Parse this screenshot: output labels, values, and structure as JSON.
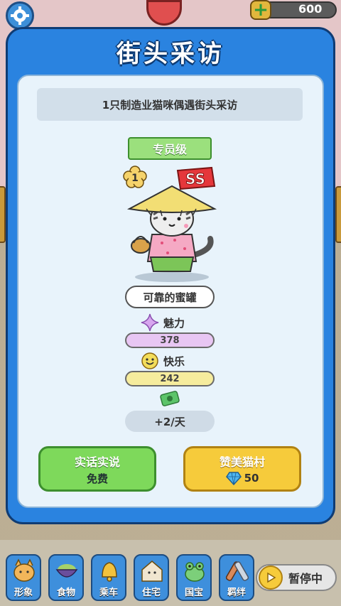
{
  "top_bar": {
    "currency_value": "600",
    "currency_icon": "plus-icon",
    "settings_icon": "gear-icon"
  },
  "dialog": {
    "title": "街头采访",
    "subtitle": "1只制造业猫咪偶遇街头采访",
    "rank": "专员级",
    "level": "1",
    "grade": "SS",
    "cat_name": "可靠的蜜罐",
    "charm": {
      "label": "魅力",
      "value": "378",
      "icon": "sparkle-icon",
      "color": "#d7a6ef"
    },
    "happiness": {
      "label": "快乐",
      "value": "242",
      "icon": "smiley-icon",
      "color": "#f3dd5a"
    },
    "income": {
      "value": "+2/天",
      "icon": "money-icon"
    },
    "buttons": {
      "honest": {
        "label": "实话实说",
        "sub": "免费"
      },
      "praise": {
        "label": "赞美猫村",
        "sub": "50",
        "icon": "diamond-icon"
      }
    }
  },
  "bottom_tabs": [
    {
      "label": "形象",
      "icon": "cat-face-icon"
    },
    {
      "label": "食物",
      "icon": "food-bowl-icon"
    },
    {
      "label": "乘车",
      "icon": "bell-icon"
    },
    {
      "label": "住宅",
      "icon": "house-cat-icon"
    },
    {
      "label": "国宝",
      "icon": "frog-icon"
    },
    {
      "label": "羁绊",
      "icon": "bond-icon"
    }
  ],
  "pause": {
    "label": "暂停中",
    "icon": "play-icon"
  },
  "colors": {
    "dialog_blue": "#2a83e0",
    "panel": "#e8f3fb",
    "green_button": "#7ed95b",
    "yellow_button": "#f6cb3b"
  }
}
